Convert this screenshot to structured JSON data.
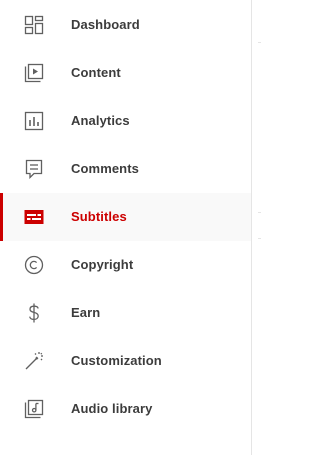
{
  "colors": {
    "active_accent": "#cc0000",
    "text": "#3c3c3c",
    "icon": "#606060",
    "active_background": "#f9f9f9"
  },
  "sidebar": {
    "items": [
      {
        "label": "Dashboard",
        "icon": "dashboard-icon",
        "active": false
      },
      {
        "label": "Content",
        "icon": "content-icon",
        "active": false
      },
      {
        "label": "Analytics",
        "icon": "analytics-icon",
        "active": false
      },
      {
        "label": "Comments",
        "icon": "comments-icon",
        "active": false
      },
      {
        "label": "Subtitles",
        "icon": "subtitles-icon",
        "active": true
      },
      {
        "label": "Copyright",
        "icon": "copyright-icon",
        "active": false
      },
      {
        "label": "Earn",
        "icon": "earn-icon",
        "active": false
      },
      {
        "label": "Customization",
        "icon": "customization-icon",
        "active": false
      },
      {
        "label": "Audio library",
        "icon": "audio-library-icon",
        "active": false
      }
    ]
  }
}
